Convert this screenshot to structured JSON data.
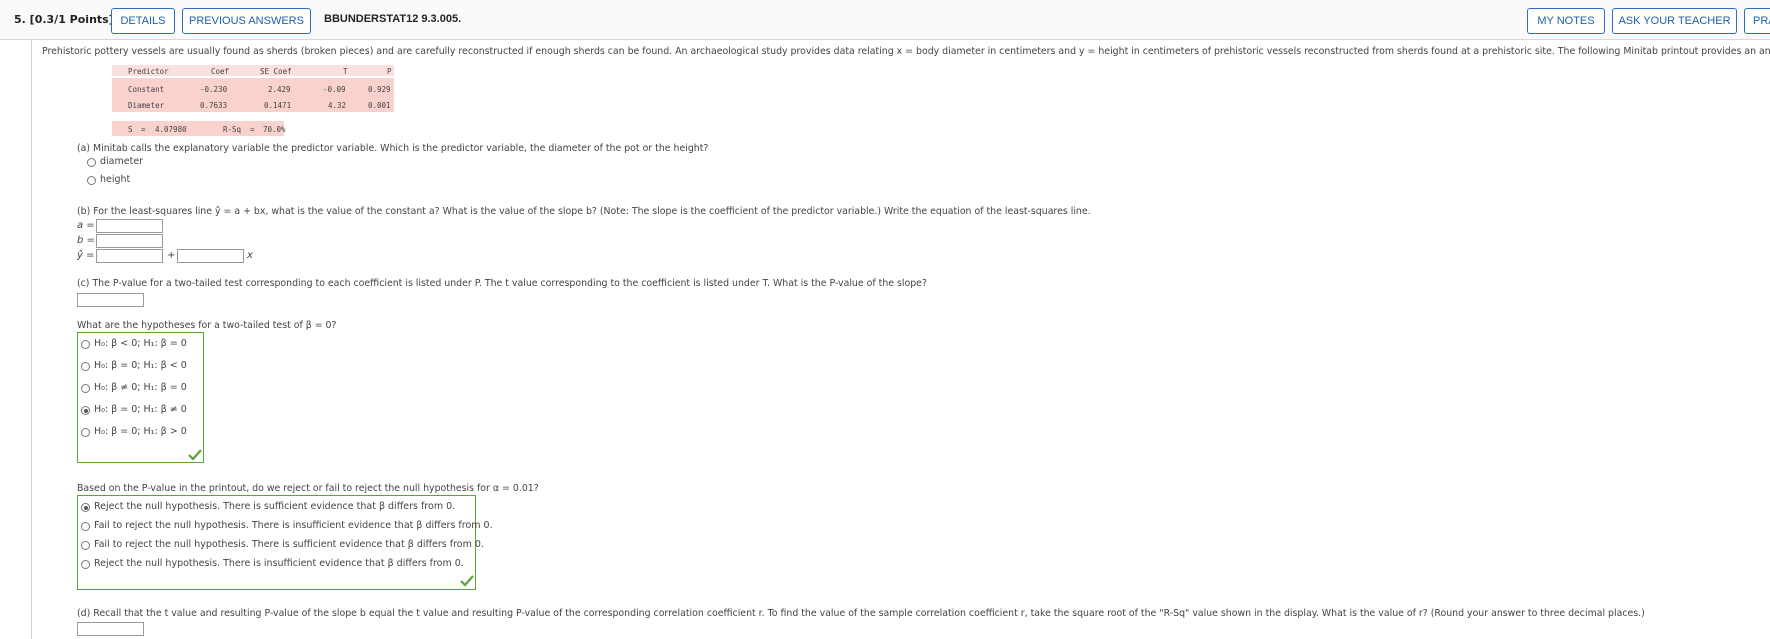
{
  "header": {
    "points": "5. [0.3/1 Points]",
    "details_label": "DETAILS",
    "previous_answers_label": "PREVIOUS ANSWERS",
    "assignment_code": "BBUNDERSTAT12 9.3.005.",
    "my_notes_label": "MY NOTES",
    "ask_teacher_label": "ASK YOUR TEACHER",
    "practice_label": "PRA"
  },
  "problem": {
    "intro": "Prehistoric pottery vessels are usually found as sherds (broken pieces) and are carefully reconstructed if enough sherds can be found. An archaeological study provides data relating x = body diameter in centimeters and y = height in centimeters of prehistoric vessels reconstructed from sherds found at a prehistoric site. The following Minitab printout provides an analysis of the data."
  },
  "printout": {
    "headers": [
      "Predictor",
      "Coef",
      "SE Coef",
      "T",
      "P"
    ],
    "rows": [
      [
        "Constant",
        "-0.230",
        "2.429",
        "-0.09",
        "0.929"
      ],
      [
        "Diameter",
        "0.7633",
        "0.1471",
        "4.32",
        "0.001"
      ]
    ],
    "s_label": "S",
    "s_value": "4.07980",
    "rsq_label": "R-Sq",
    "rsq_value": "70.0%",
    "eq": "="
  },
  "part_a": {
    "question": "(a) Minitab calls the explanatory variable the predictor variable. Which is the predictor variable, the diameter of the pot or the height?",
    "options": [
      "diameter",
      "height"
    ]
  },
  "part_b": {
    "question": "(b) For the least-squares line ŷ = a + bx, what is the value of the constant a? What is the value of the slope b? (Note: The slope is the coefficient of the predictor variable.) Write the equation of the least-squares line.",
    "a_label": "a =",
    "b_label": "b =",
    "yhat_label": "ŷ =",
    "plus": "+",
    "x_suffix": "x",
    "a_value": "",
    "b_value": "",
    "yhat_a_value": "",
    "yhat_b_value": ""
  },
  "part_c": {
    "question": "(c) The P-value for a two-tailed test corresponding to each coefficient is listed under P. The t value corresponding to the coefficient is listed under T. What is the P-value of the slope?",
    "pvalue_value": "",
    "hyp_question": "What are the hypotheses for a two-tailed test of β = 0?",
    "hyp_options": [
      "H₀: β < 0; H₁: β = 0",
      "H₀: β = 0; H₁: β < 0",
      "H₀: β ≠ 0; H₁: β = 0",
      "H₀: β = 0; H₁: β ≠ 0",
      "H₀: β = 0; H₁: β > 0"
    ],
    "hyp_selected_index": 3,
    "decision_question": "Based on the P-value in the printout, do we reject or fail to reject the null hypothesis for α = 0.01?",
    "decision_options": [
      "Reject the null hypothesis. There is sufficient evidence that β differs from 0.",
      "Fail to reject the null hypothesis. There is insufficient evidence that β differs from 0.",
      "Fail to reject the null hypothesis. There is sufficient evidence that β differs from 0.",
      "Reject the null hypothesis. There is insufficient evidence that β differs from 0."
    ],
    "decision_selected_index": 0
  },
  "part_d": {
    "question": "(d) Recall that the t value and resulting P-value of the slope b equal the t value and resulting P-value of the corresponding correlation coefficient r. To find the value of the sample correlation coefficient r, take the square root of the \"R-Sq\" value shown in the display. What is the value of r? (Round your answer to three decimal places.)",
    "r_value": ""
  },
  "colors": {
    "accent": "#2a6fbf",
    "correct_green": "#5aa538",
    "printout_pink": "#f9d2cd"
  }
}
